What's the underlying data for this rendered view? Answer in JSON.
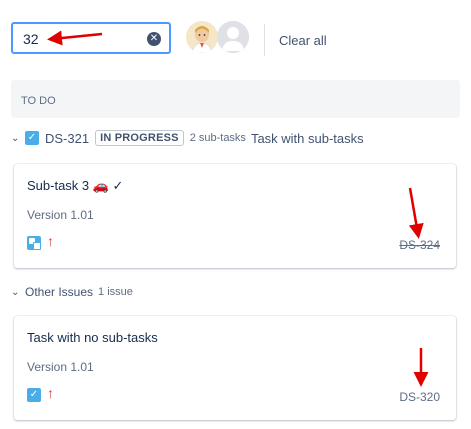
{
  "search": {
    "value": "32"
  },
  "toolbar": {
    "clear_all_label": "Clear all"
  },
  "column": {
    "title": "TO DO"
  },
  "parent": {
    "key": "DS-321",
    "status": "IN PROGRESS",
    "subtask_count": "2 sub-tasks",
    "summary": "Task with sub-tasks"
  },
  "cards": [
    {
      "title": "Sub-task 3 🚗 ✓",
      "version": "Version 1.01",
      "key": "DS-324",
      "issue_type": "subtask-icon",
      "priority": "high-priority-arrow-icon"
    },
    {
      "title": "Task with no sub-tasks",
      "version": "Version 1.01",
      "key": "DS-320",
      "issue_type": "task-icon",
      "priority": "high-priority-arrow-icon"
    }
  ],
  "other_group": {
    "label": "Other Issues",
    "count": "1 issue"
  },
  "colors": {
    "focus_border": "#4c9aff",
    "issue_blue": "#4bade8",
    "priority_red": "#d04437",
    "annotation_red": "#e00000"
  }
}
